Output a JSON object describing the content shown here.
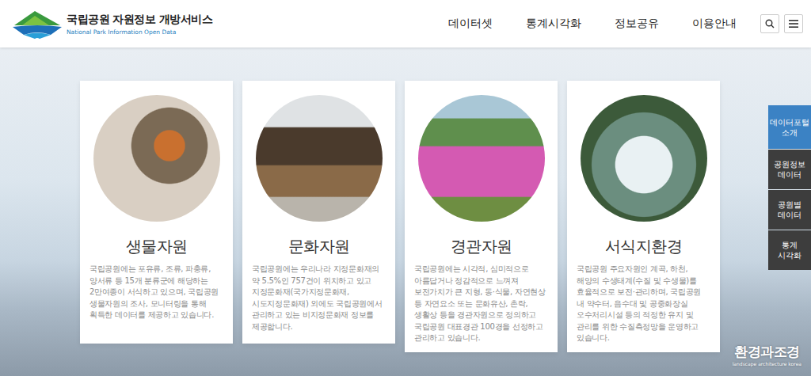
{
  "header": {
    "title": "국립공원 자원정보 개방서비스",
    "subtitle": "National Park Information Open Data",
    "nav": [
      "데이터셋",
      "통계시각화",
      "정보공유",
      "이용안내"
    ]
  },
  "cards": [
    {
      "title": "생물자원",
      "description": "국립공원에는 포유류, 조류, 파충류, 양서류 등 15개 분류군에 해당하는 2만여종이 서식하고 있으며, 국립공원 생물자원의 조사, 모니터링을 통해 획득한 데이터를 제공하고 있습니다."
    },
    {
      "title": "문화자원",
      "description": "국립공원에는 우리나라 지정문화재의 약 5.5%인 757건이 위치하고 있고 지정문화재(국가지정문화재, 시도지정문화재) 외에도 국립공원에서 관리하고 있는 비지정문화재 정보를 제공합니다."
    },
    {
      "title": "경관자원",
      "description": "국립공원에는 시각적, 심미적으로 아름답거나 정감적으로 느껴져 보전가치가 큰 지형, 동·식물, 자연현상 등 자연요소 또는 문화유산, 촌락, 생활상 등을 경관자원으로 정의하고 국립공원 대표경관 100경을 선정하고 관리하고 있습니다."
    },
    {
      "title": "서식지환경",
      "description": "국립공원 주요자원인 계곡, 하천, 해양의 수생태계(수질 및 수생물)를 효율적으로 보전·관리하며, 국립공원 내 약수터, 음수대 및 공중화장실 오수처리시설 등의 적정한 유지 및 관리를 위한 수질측정망을 운영하고 있습니다."
    }
  ],
  "side_menu": [
    {
      "label": "데이터포털 소개",
      "selected": true
    },
    {
      "label": "공원정보 데이터",
      "selected": false
    },
    {
      "label": "공원별 데이터",
      "selected": false
    },
    {
      "label": "통계 시각화",
      "selected": false
    }
  ],
  "watermark": {
    "title": "환경과조경",
    "subtitle": "landscape architecture korea"
  }
}
